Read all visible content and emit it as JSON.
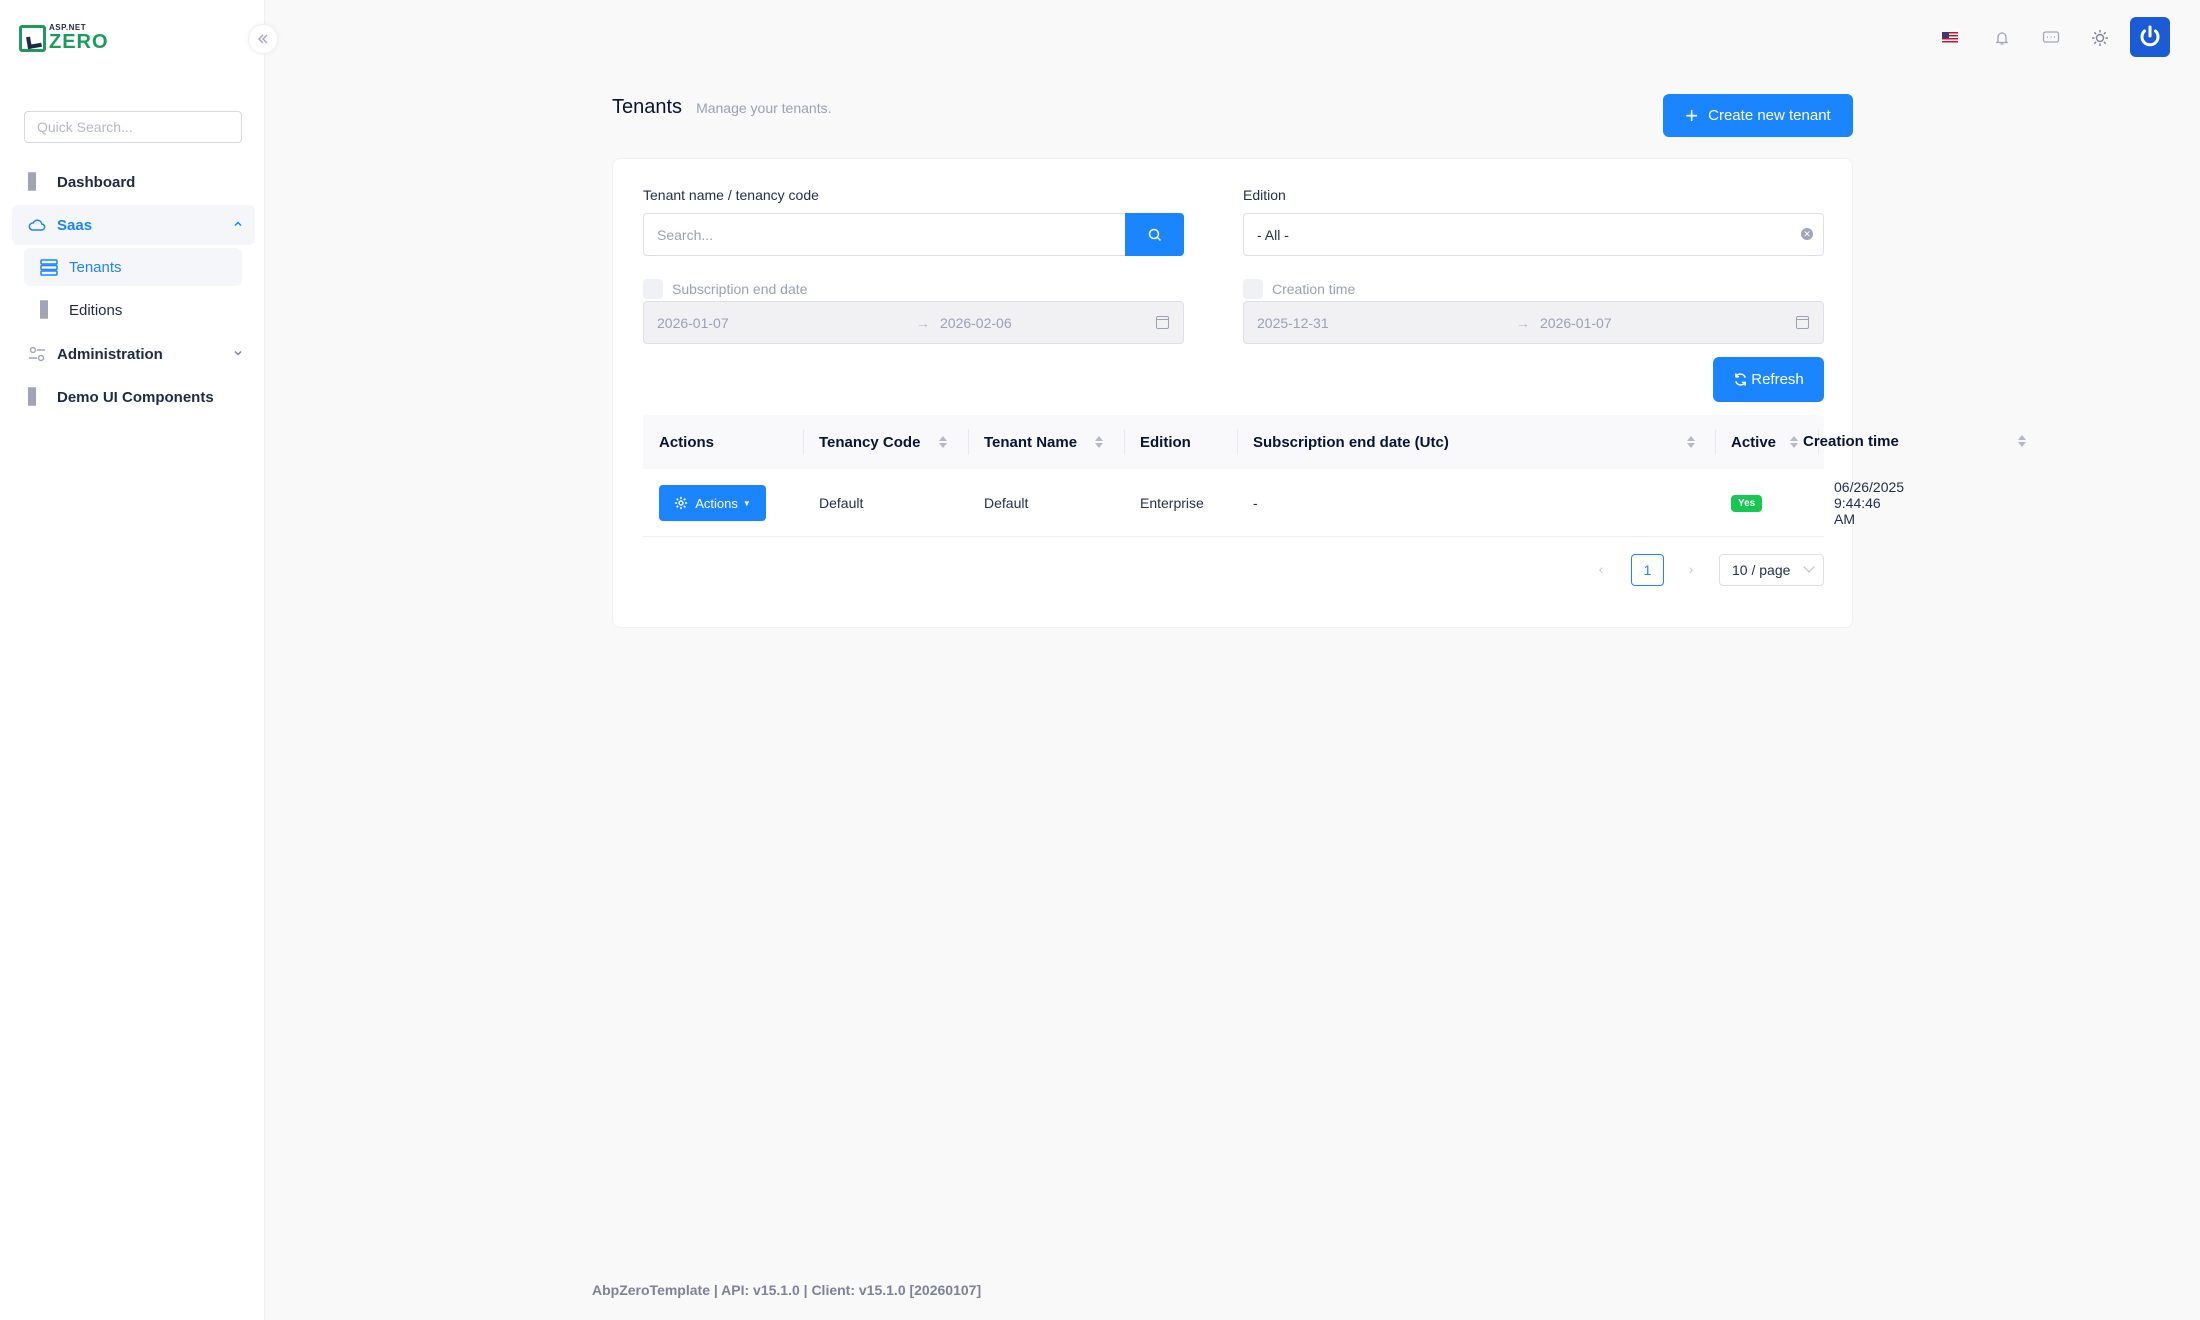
{
  "brand": {
    "logo_small": "ASP.NET",
    "logo_big": "ZERO"
  },
  "sidebar": {
    "search_placeholder": "Quick Search...",
    "items": [
      {
        "label": "Dashboard"
      },
      {
        "label": "Saas",
        "expanded": true,
        "children": [
          {
            "label": "Tenants",
            "active": true
          },
          {
            "label": "Editions"
          }
        ]
      },
      {
        "label": "Administration"
      },
      {
        "label": "Demo UI Components"
      }
    ]
  },
  "page": {
    "title": "Tenants",
    "subtitle": "Manage your tenants.",
    "create_button": "Create new tenant"
  },
  "filters": {
    "name_label": "Tenant name / tenancy code",
    "search_placeholder": "Search...",
    "edition_label": "Edition",
    "edition_value": "- All -",
    "subscription_label": "Subscription end date",
    "subscription_from": "2026-01-07",
    "subscription_to": "2026-02-06",
    "creation_label": "Creation time",
    "creation_from": "2025-12-31",
    "creation_to": "2026-01-07",
    "refresh_button": "Refresh"
  },
  "table": {
    "columns": [
      "Actions",
      "Tenancy Code",
      "Tenant Name",
      "Edition",
      "Subscription end date (Utc)",
      "Active",
      "Creation time"
    ],
    "rows": [
      {
        "actions": "Actions",
        "tenancy_code": "Default",
        "tenant_name": "Default",
        "edition": "Enterprise",
        "subscription_end": "-",
        "active": "Yes",
        "creation_time": "06/26/2025 9:44:46 AM"
      }
    ]
  },
  "pagination": {
    "current_page": "1",
    "page_size": "10 / page"
  },
  "footer": {
    "text": "AbpZeroTemplate | API: v15.1.0 | Client: v15.1.0 [20260107]"
  },
  "colors": {
    "primary": "#1b84ff",
    "success": "#17c653",
    "brand_green": "#1b9c5a"
  }
}
